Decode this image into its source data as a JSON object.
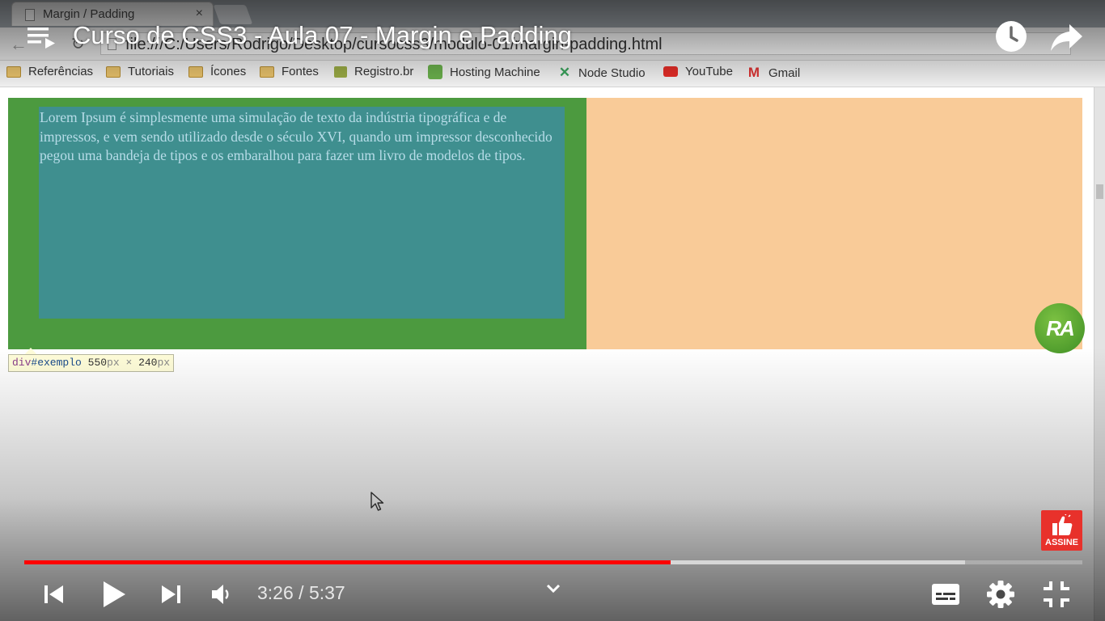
{
  "browser": {
    "tab_title": "Margin / Padding",
    "tab_close": "×",
    "address_text": "file:///C:/Users/Rodrigo/Desktop/cursocss3/modulo-01/margin-padding.html",
    "bookmarks": [
      {
        "label": "Referências",
        "icon": "folder-icon"
      },
      {
        "label": "Tutoriais",
        "icon": "folder-icon"
      },
      {
        "label": "Ícones",
        "icon": "folder-icon"
      },
      {
        "label": "Fontes",
        "icon": "folder-icon"
      },
      {
        "label": "Registro.br",
        "icon": "registro-icon"
      },
      {
        "label": "Hosting Machine",
        "icon": "hosting-machine-icon"
      },
      {
        "label": "Node Studio",
        "icon": "node-studio-icon"
      },
      {
        "label": "YouTube",
        "icon": "youtube-icon"
      },
      {
        "label": "Gmail",
        "icon": "gmail-icon"
      }
    ]
  },
  "page": {
    "lorem_text": "Lorem Ipsum é simplesmente uma simulação de texto da indústria tipográfica e de impressos, e vem sendo utilizado desde o século XVI, quando um impressor desconhecido pegou uma bandeja de tipos e os embaralhou para fazer um livro de modelos de tipos.",
    "inspector_tooltip": {
      "tag": "div",
      "id": "#exemplo",
      "width": "550",
      "height": "240",
      "unit": "px",
      "separator": " × "
    },
    "colors": {
      "green_box": "#4c9a3f",
      "teal_box": "#3f8f8f",
      "orange_box": "#f9cb98"
    }
  },
  "player": {
    "video_title": "Curso de CSS3 - Aula 07 - Margin e Padding",
    "time_current": "3:26",
    "time_separator": " / ",
    "time_total": "5:37",
    "progress_played_fraction": 0.611,
    "progress_loaded_fraction": 0.889,
    "accent_color": "#ff0000",
    "channel_badge": "RA",
    "subscribe_label": "ASSINE"
  }
}
